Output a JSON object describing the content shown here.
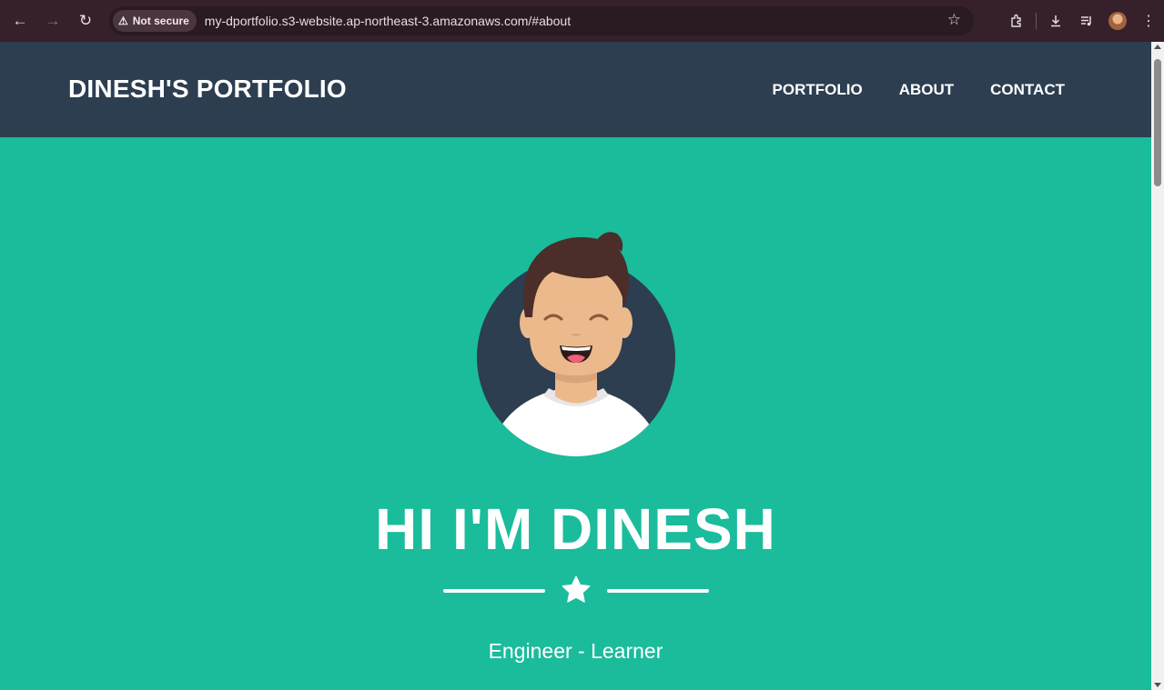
{
  "browser": {
    "security_label": "Not secure",
    "url": "my-dportfolio.s3-website.ap-northeast-3.amazonaws.com/#about",
    "icons": [
      "back-icon",
      "forward-icon",
      "reload-icon",
      "warning-icon",
      "bookmark-star-icon",
      "extensions-icon",
      "download-icon",
      "media-control-icon",
      "profile-avatar",
      "menu-icon"
    ]
  },
  "site": {
    "brand": "DINESH'S PORTFOLIO",
    "nav": [
      {
        "label": "PORTFOLIO"
      },
      {
        "label": "ABOUT"
      },
      {
        "label": "CONTACT"
      }
    ]
  },
  "hero": {
    "title": "HI I'M DINESH",
    "subtitle": "Engineer - Learner"
  },
  "colors": {
    "hero_bg": "#1abc9c",
    "nav_bg": "#2c3e50",
    "browser_chrome": "#35202b"
  }
}
